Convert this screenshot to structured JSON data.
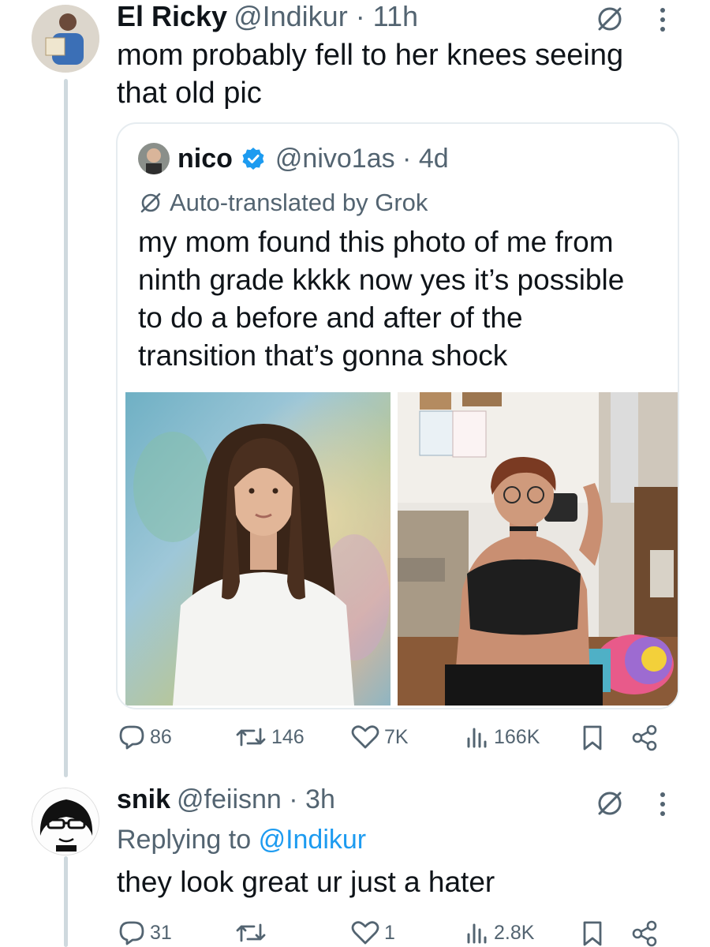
{
  "tweet": {
    "display_name": "El Ricky",
    "handle_time": "@Indikur · 11h",
    "text_line1": "mom probably fell to her knees seeing",
    "text_line2": "that old pic"
  },
  "quote": {
    "display_name": "nico",
    "handle_time": "@nivo1as · 4d",
    "translation_note": "Auto-translated by Grok",
    "text_lines": [
      "my mom found this photo of me from",
      "ninth grade kkkk now yes it’s possible",
      "to do a before and after of the",
      "transition that’s gonna shock"
    ]
  },
  "tweet_actions": {
    "replies": "86",
    "reposts": "146",
    "likes": "7K",
    "views": "166K"
  },
  "reply": {
    "display_name": "snik",
    "handle_time": "@feiisnn · 3h",
    "replying_prefix": "Replying to",
    "replying_handle": "@Indikur",
    "text": "they look great ur just a hater"
  },
  "reply_actions": {
    "replies": "31",
    "reposts": "",
    "likes": "1",
    "views": "2.8K"
  },
  "colors": {
    "text": "#0f1419",
    "muted": "#536471",
    "link": "#1d9bf0",
    "verified": "#1d9bf0",
    "border": "#e6ecf0",
    "thread_line": "#cfd9de"
  }
}
